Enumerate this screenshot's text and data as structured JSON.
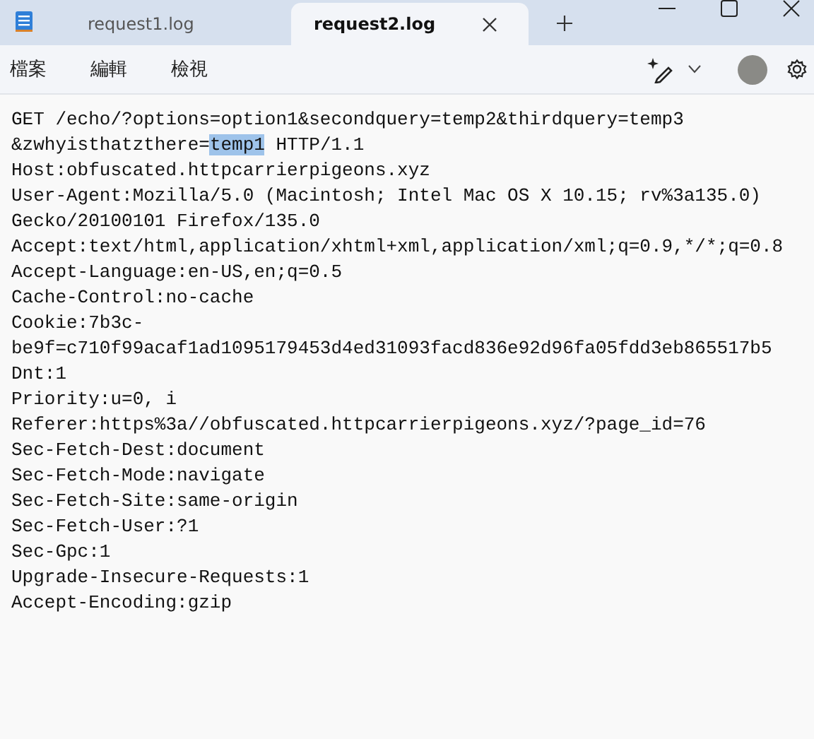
{
  "tabs": [
    {
      "label": "request1.log",
      "selected": false
    },
    {
      "label": "request2.log",
      "selected": true
    }
  ],
  "menu": [
    "檔案",
    "編輯",
    "檢視"
  ],
  "editor": {
    "lines": [
      {
        "kind": "plain",
        "text": "GET /echo/?options=option1&secondquery=temp2&thirdquery=temp3"
      },
      {
        "kind": "selection",
        "before": "&zwhyisthatzthere=",
        "selected_text": "temp1",
        "after": " HTTP/1.1"
      },
      {
        "kind": "plain",
        "text": "Host:obfuscated.httpcarrierpigeons.xyz"
      },
      {
        "kind": "plain",
        "text": "User-Agent:Mozilla/5.0 (Macintosh; Intel Mac OS X 10.15; rv%3a135.0)"
      },
      {
        "kind": "plain",
        "text": "Gecko/20100101 Firefox/135.0"
      },
      {
        "kind": "plain",
        "text": "Accept:text/html,application/xhtml+xml,application/xml;q=0.9,*/*;q=0.8"
      },
      {
        "kind": "plain",
        "text": "Accept-Language:en-US,en;q=0.5"
      },
      {
        "kind": "plain",
        "text": "Cache-Control:no-cache"
      },
      {
        "kind": "plain",
        "text": "Cookie:7b3c-"
      },
      {
        "kind": "plain",
        "text": "be9f=c710f99acaf1ad1095179453d4ed31093facd836e92d96fa05fdd3eb865517b5"
      },
      {
        "kind": "plain",
        "text": "Dnt:1"
      },
      {
        "kind": "plain",
        "text": "Priority:u=0, i"
      },
      {
        "kind": "plain",
        "text": "Referer:https%3a//obfuscated.httpcarrierpigeons.xyz/?page_id=76"
      },
      {
        "kind": "plain",
        "text": "Sec-Fetch-Dest:document"
      },
      {
        "kind": "plain",
        "text": "Sec-Fetch-Mode:navigate"
      },
      {
        "kind": "plain",
        "text": "Sec-Fetch-Site:same-origin"
      },
      {
        "kind": "plain",
        "text": "Sec-Fetch-User:?1"
      },
      {
        "kind": "plain",
        "text": "Sec-Gpc:1"
      },
      {
        "kind": "plain",
        "text": "Upgrade-Insecure-Requests:1"
      },
      {
        "kind": "plain",
        "text": "Accept-Encoding:gzip"
      }
    ]
  }
}
